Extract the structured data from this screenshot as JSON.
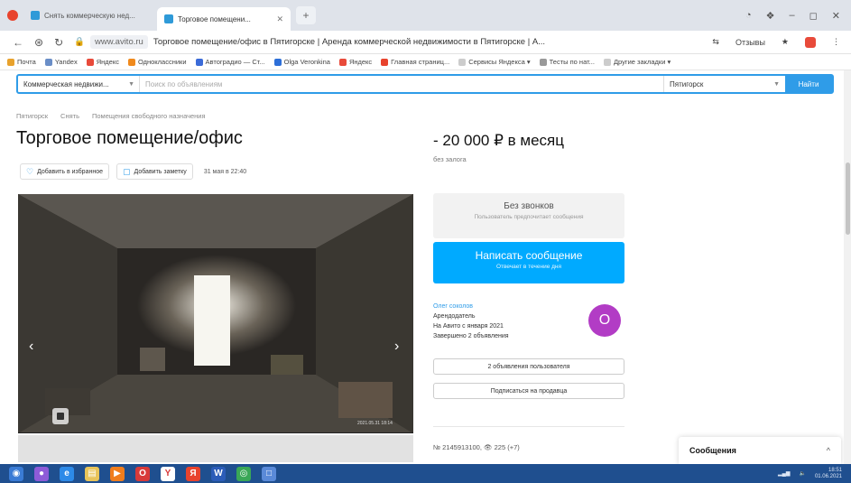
{
  "browser": {
    "tabs": [
      {
        "label": "Снять коммерческую нед...",
        "active": false
      },
      {
        "label": "Торговое помещени...",
        "active": true
      }
    ],
    "new_tab": "+",
    "window_controls": [
      "◔",
      "❖",
      "–",
      "◻",
      "✕"
    ],
    "url_host": "www.avito.ru",
    "url_title": "Торговое помещение/офис в Пятигорске | Аренда коммерческой недвижимости в Пятигорске | А...",
    "address_right": {
      "reader": "⇆",
      "account_label": "Отзывы",
      "star": "★",
      "more": "⋮"
    }
  },
  "bookmarks": [
    {
      "label": "Почта",
      "color": "#e8a22d"
    },
    {
      "label": "Yandex",
      "color": "#6a8ec7"
    },
    {
      "label": "Яндекс",
      "color": "#e84a3a"
    },
    {
      "label": "Одноклассники",
      "color": "#f08a1d"
    },
    {
      "label": "Автоградио — Ст...",
      "color": "#3b6bd8"
    },
    {
      "label": "Olga Veronkina",
      "color": "#2d6fd8"
    },
    {
      "label": "Яндекс",
      "color": "#e84a3a"
    },
    {
      "label": "Главная страниц...",
      "color": "#e8432d"
    },
    {
      "label": "Сервисы Яндекса ▾",
      "color": "#cccccc"
    },
    {
      "label": "Тесты по нат...",
      "color": "#999999"
    },
    {
      "label": "Другие закладки ▾",
      "color": "#cccccc"
    }
  ],
  "search": {
    "category": "Коммерческая недвижи...",
    "placeholder": "Поиск по объявлениям",
    "city": "Пятигорск",
    "find_label": "Найти"
  },
  "breadcrumb": [
    "Пятигорск",
    "Снять",
    "Помещения свободного назначения"
  ],
  "listing": {
    "title": "Торговое помещение/офис",
    "price": "- 20 000 ₽ в месяц",
    "deposit": "без залога",
    "favorite_label": "Добавить в избранное",
    "note_label": "Добавить заметку",
    "date": "31 мая в 22:40",
    "photo_stamp": "2021.05.31  18:14",
    "meta": "№ 2145913100,  👁 225 (+7)"
  },
  "contact": {
    "nocalls_title": "Без звонков",
    "nocalls_sub": "Пользователь предпочитает сообщения",
    "message_title": "Написать сообщение",
    "message_sub": "Отвечает в течение дня",
    "seller_name": "Олег соколов",
    "seller_role": "Арендодатель",
    "seller_since": "На Авито с января 2021",
    "seller_done": "Завершено 2 объявления",
    "avatar_letter": "О",
    "user_ads_label": "2 объявления пользователя",
    "subscribe_label": "Подписаться на продавца"
  },
  "messages_widget": {
    "title": "Сообщения",
    "chevron": "^"
  },
  "taskbar": {
    "icons": [
      {
        "name": "start",
        "color": "#3a7bd5",
        "glyph": "◉"
      },
      {
        "name": "app",
        "color": "#8e5bd8",
        "glyph": "●"
      },
      {
        "name": "ie",
        "color": "#2d8ae8",
        "glyph": "e"
      },
      {
        "name": "explorer",
        "color": "#e8c45a",
        "glyph": "▤"
      },
      {
        "name": "media",
        "color": "#f07d1d",
        "glyph": "▶"
      },
      {
        "name": "opera",
        "color": "#d83a3a",
        "glyph": "O"
      },
      {
        "name": "yandex",
        "color": "#ffffff",
        "glyph": "Y"
      },
      {
        "name": "yandex-browser",
        "color": "#e8432d",
        "glyph": "Я"
      },
      {
        "name": "word",
        "color": "#2b5cb8",
        "glyph": "W"
      },
      {
        "name": "chrome",
        "color": "#3aa757",
        "glyph": "◎"
      },
      {
        "name": "window",
        "color": "#5a8ad8",
        "glyph": "□"
      }
    ],
    "time": "18:51",
    "date": "01.06.2021"
  }
}
